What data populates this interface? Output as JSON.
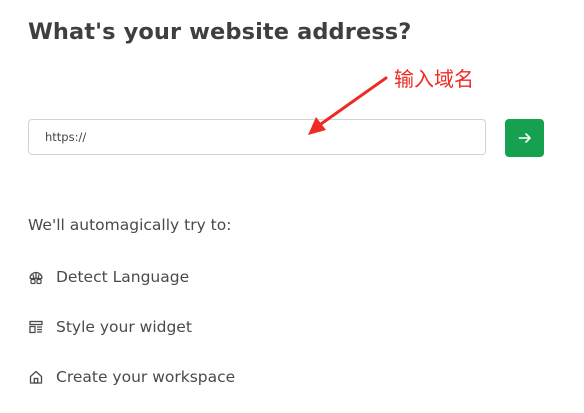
{
  "header": {
    "title": "What's your website address?"
  },
  "url_field": {
    "value": "",
    "placeholder": "https://"
  },
  "submit_button": {
    "icon": "arrow-right-icon",
    "color": "#15a14f"
  },
  "annotation": {
    "text": "输入域名",
    "color": "#ee2a25"
  },
  "features": {
    "intro": "We'll automagically try to:",
    "items": [
      {
        "icon": "language-icon",
        "label": "Detect Language"
      },
      {
        "icon": "layout-icon",
        "label": "Style your widget"
      },
      {
        "icon": "home-icon",
        "label": "Create your workspace"
      }
    ]
  }
}
